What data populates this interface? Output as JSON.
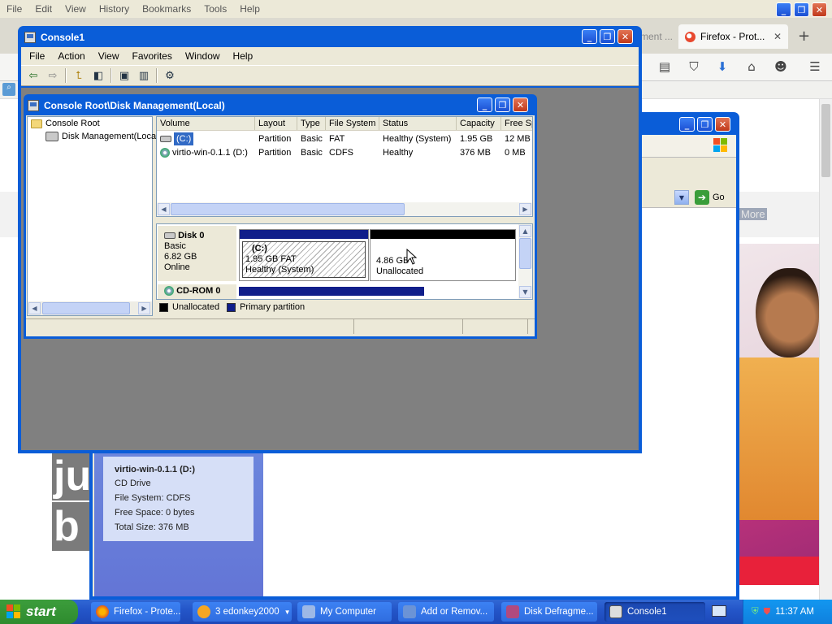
{
  "firefox": {
    "menus": [
      {
        "label": "File"
      },
      {
        "label": "Edit"
      },
      {
        "label": "View"
      },
      {
        "label": "History"
      },
      {
        "label": "Bookmarks"
      },
      {
        "label": "Tools"
      },
      {
        "label": "Help"
      }
    ],
    "window_buttons": {
      "min": "_",
      "max": "❐",
      "close": "✕"
    },
    "tab_partial": "ment ...",
    "tab_title": "Firefox - Prot...",
    "tab_close": "✕",
    "new_tab": "+",
    "nav_icons": [
      "reader-icon",
      "pocket-icon",
      "download-icon",
      "home-icon",
      "smiley-icon",
      "menu-icon"
    ],
    "page_more": "More",
    "page_letters": [
      "ju",
      "b"
    ]
  },
  "my_computer": {
    "go_label": "Go",
    "dropdown": "▼",
    "details": {
      "title": "virtio-win-0.1.1 (D:)",
      "type": "CD Drive",
      "file_system": "File System: CDFS",
      "free_space": "Free Space: 0 bytes",
      "total_size": "Total Size: 376 MB"
    }
  },
  "console": {
    "title": "Console1",
    "menus": [
      "File",
      "Action",
      "View",
      "Favorites",
      "Window",
      "Help"
    ],
    "toolbar_icons": [
      "back-icon",
      "forward-icon",
      "up-folder-icon",
      "show-hide-tree-icon",
      "properties-icon",
      "help-icon",
      "export-list-icon",
      "settings-icon"
    ]
  },
  "disk_mgmt": {
    "title": "Console Root\\Disk Management(Local)",
    "tree": {
      "root": "Console Root",
      "child": "Disk Management(Local)"
    },
    "columns": [
      "Volume",
      "Layout",
      "Type",
      "File System",
      "Status",
      "Capacity",
      "Free Sp"
    ],
    "volumes": [
      {
        "volume": "(C:)",
        "layout": "Partition",
        "type": "Basic",
        "fs": "FAT",
        "status": "Healthy (System)",
        "capacity": "1.95 GB",
        "free": "12 MB"
      },
      {
        "volume": "virtio-win-0.1.1 (D:)",
        "layout": "Partition",
        "type": "Basic",
        "fs": "CDFS",
        "status": "Healthy",
        "capacity": "376 MB",
        "free": "0 MB"
      }
    ],
    "disk0": {
      "name": "Disk 0",
      "kind": "Basic",
      "size": "6.82 GB",
      "state": "Online",
      "part_c": {
        "label": "(C:)",
        "size": "1.95 GB FAT",
        "status": "Healthy (System)"
      },
      "part_unalloc": {
        "size": "4.86 GB",
        "status": "Unallocated"
      }
    },
    "cdrom": {
      "name": "CD-ROM 0"
    },
    "legend": {
      "unallocated": "Unallocated",
      "primary": "Primary partition"
    },
    "colors": {
      "primary": "#101e8a",
      "unallocated": "#000000"
    }
  },
  "taskbar": {
    "start": "start",
    "tasks": [
      {
        "label": "Firefox - Prote...",
        "icon": "firefox-icon"
      },
      {
        "label": "3 edonkey2000",
        "icon": "edonkey-icon"
      },
      {
        "label": "My Computer",
        "icon": "my-computer-icon"
      },
      {
        "label": "Add or Remov...",
        "icon": "add-remove-icon"
      },
      {
        "label": "Disk Defragme...",
        "icon": "defrag-icon"
      },
      {
        "label": "Console1",
        "icon": "console-icon"
      }
    ],
    "clock": "11:37 AM"
  }
}
